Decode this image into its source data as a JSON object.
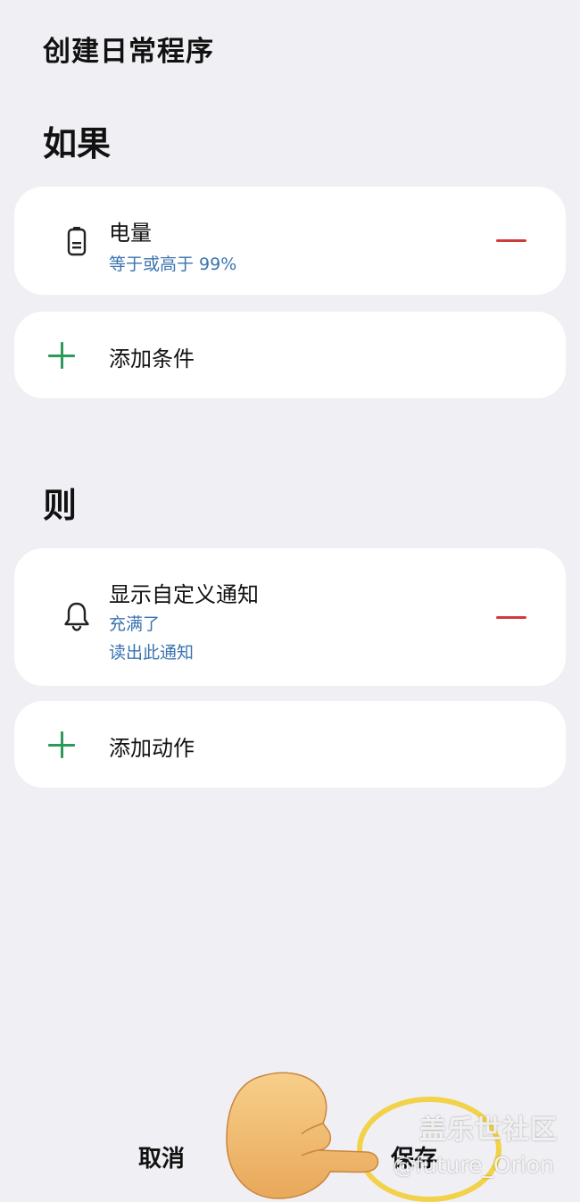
{
  "header": {
    "title": "创建日常程序"
  },
  "if_section": {
    "heading": "如果",
    "conditions": [
      {
        "icon": "battery-icon",
        "title": "电量",
        "detail": "等于或高于 99%"
      }
    ],
    "add_label": "添加条件"
  },
  "then_section": {
    "heading": "则",
    "actions": [
      {
        "icon": "bell-icon",
        "title": "显示自定义通知",
        "details": [
          "充满了",
          "读出此通知"
        ]
      }
    ],
    "add_label": "添加动作"
  },
  "footer": {
    "cancel_label": "取消",
    "save_label": "保存"
  },
  "watermark": {
    "line1": "盖乐世社区",
    "line2": "@future_Orion"
  },
  "colors": {
    "background": "#f0f0f4",
    "card": "#ffffff",
    "accent_blue": "#3a73b0",
    "add_green": "#2e9a5a",
    "remove_red": "#d23a3a",
    "highlight_yellow": "#f2d24a"
  }
}
